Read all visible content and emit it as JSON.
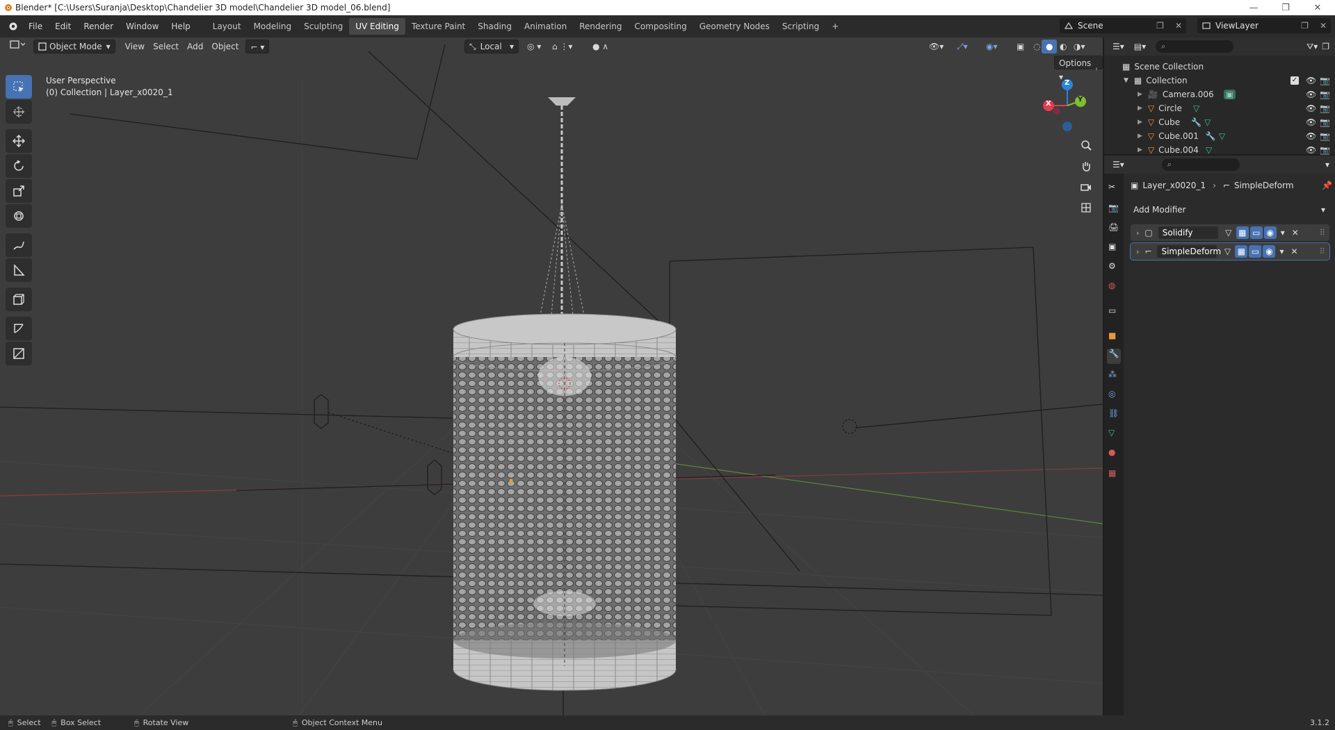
{
  "window": {
    "title": "Blender* [C:\\Users\\Suranja\\Desktop\\Chandelier 3D model\\Chandelier 3D model_06.blend]"
  },
  "menu": {
    "items": [
      "File",
      "Edit",
      "Render",
      "Window",
      "Help"
    ]
  },
  "workspaces": {
    "tabs": [
      "Layout",
      "Modeling",
      "Sculpting",
      "UV Editing",
      "Texture Paint",
      "Shading",
      "Animation",
      "Rendering",
      "Compositing",
      "Geometry Nodes",
      "Scripting"
    ],
    "active": "UV Editing",
    "add_label": "+"
  },
  "scene": {
    "label": "Scene",
    "view_layer": "ViewLayer"
  },
  "viewport_header": {
    "mode": "Object Mode",
    "menus": [
      "View",
      "Select",
      "Add",
      "Object"
    ],
    "transform_orientation": "Local",
    "options_label": "Options"
  },
  "viewport": {
    "perspective_label": "User Perspective",
    "collection_label": "(0) Collection | Layer_x0020_1",
    "gizmo": {
      "x": "X",
      "y": "Y",
      "z": "Z"
    }
  },
  "outliner": {
    "root": "Scene Collection",
    "collection": "Collection",
    "objects": [
      "Camera.006",
      "Circle",
      "Cube",
      "Cube.001",
      "Cube.004"
    ]
  },
  "properties": {
    "breadcrumb_object": "Layer_x0020_1",
    "breadcrumb_modifier": "SimpleDeform",
    "add_modifier_label": "Add Modifier",
    "modifiers": [
      "Solidify",
      "SimpleDeform"
    ]
  },
  "statusbar": {
    "select": "Select",
    "box_select": "Box Select",
    "rotate_view": "Rotate View",
    "context_menu": "Object Context Menu",
    "version": "3.1.2"
  },
  "colors": {
    "accent": "#4772b3",
    "viewport_bg": "#3d3d3d",
    "axis_x": "#e63a4e",
    "axis_y": "#7fbf2f",
    "axis_z": "#2c83d8"
  }
}
